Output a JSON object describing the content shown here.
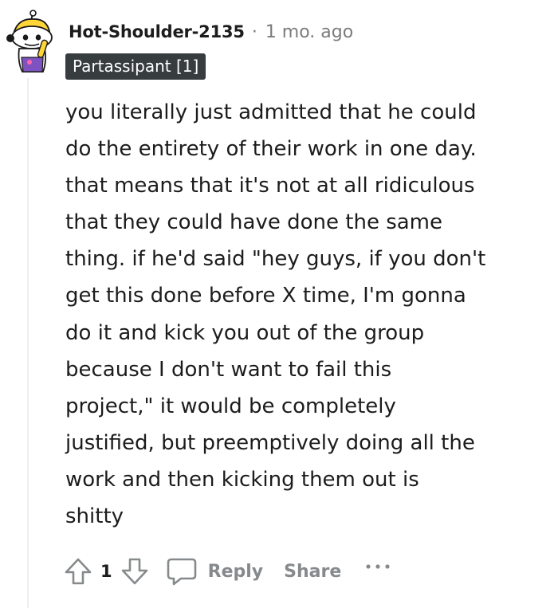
{
  "comment": {
    "username": "Hot-Shoulder-2135",
    "separator": "·",
    "timestamp": "1 mo. ago",
    "flair": "Partassipant [1]",
    "body_lines": [
      "you literally just admitted that he could",
      "do the entirety of their work in one day.",
      "that means that it's not at all ridiculous",
      "that they could have done the same",
      "thing. if he'd said \"hey guys, if you don't",
      "get this done before X time, I'm gonna",
      "do it and kick you out of the group",
      "because I don't want to fail this",
      "project,\" it would be completely",
      "justified, but preemptively doing all the",
      "work and then kicking them out is",
      "shitty"
    ]
  },
  "actions": {
    "vote_count": "1",
    "reply_label": "Reply",
    "share_label": "Share",
    "upvote_icon": "upvote-arrow-icon",
    "downvote_icon": "downvote-arrow-icon",
    "reply_icon": "speech-bubble-icon",
    "more_icon": "ellipsis-icon"
  },
  "colors": {
    "text_primary": "#1c1c1c",
    "text_muted": "#878a8c",
    "flair_bg": "#373c3f",
    "flair_text": "#ffffff",
    "avatar_accent": "#ffd635",
    "avatar_purple": "#7e53c1"
  }
}
